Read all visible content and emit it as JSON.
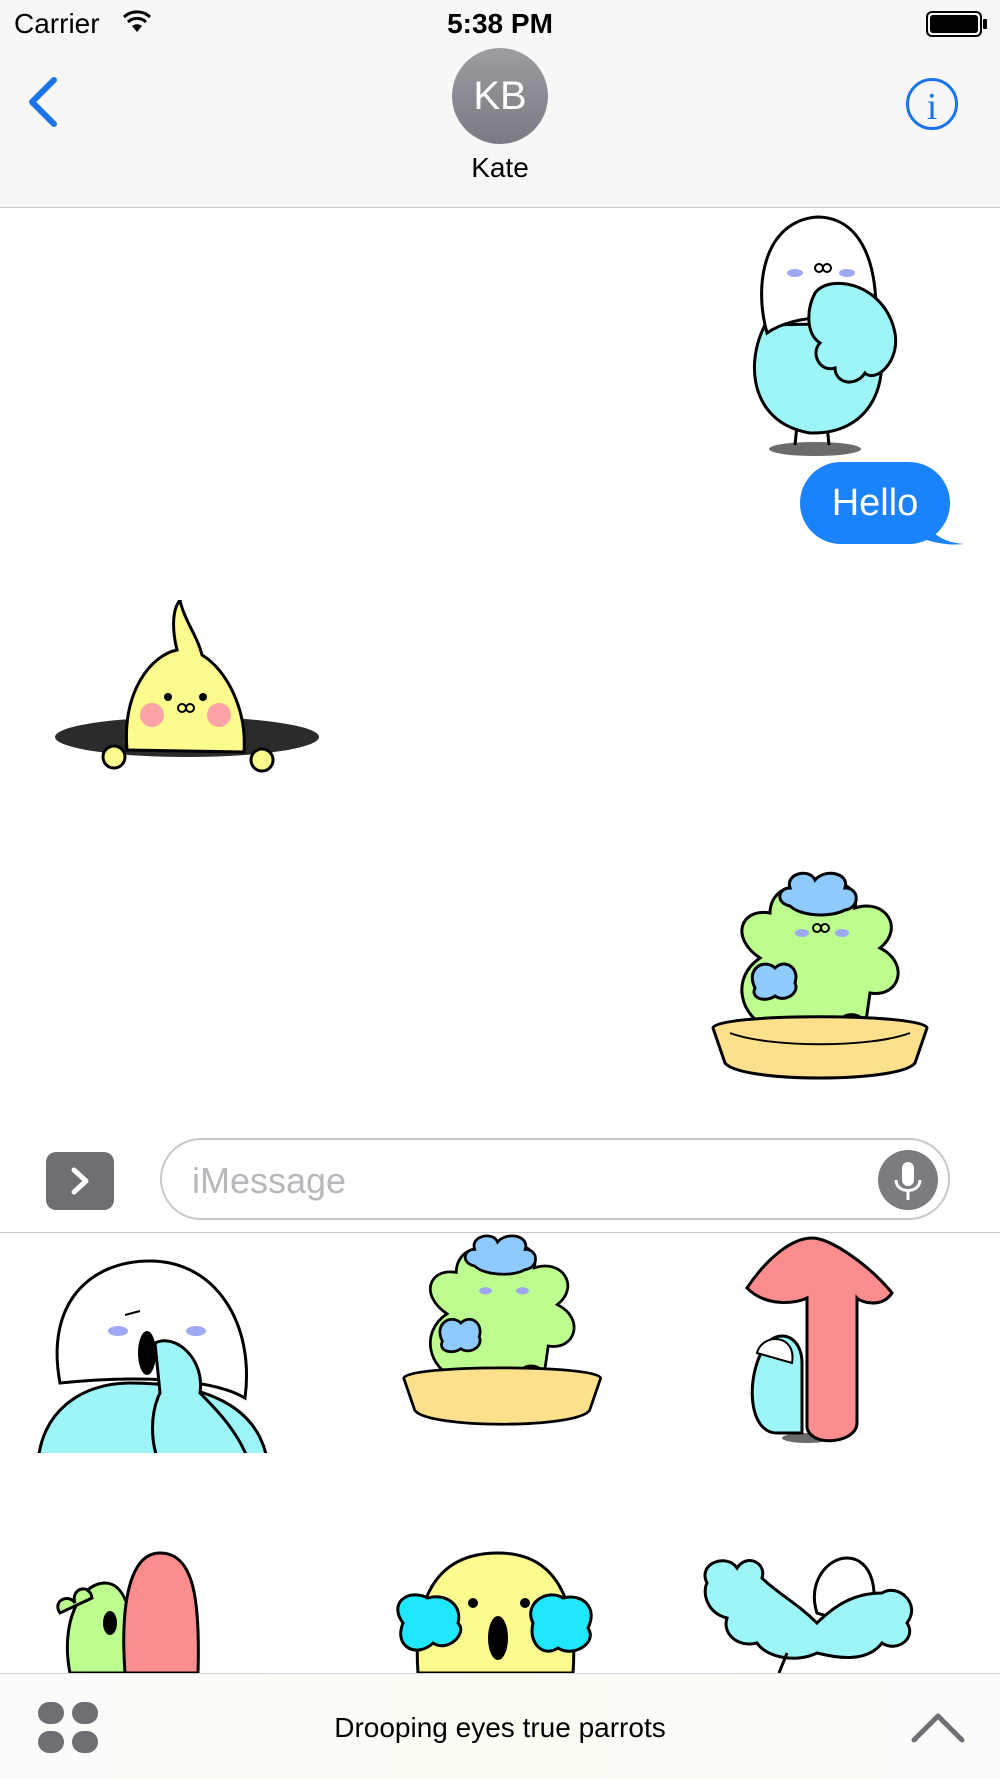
{
  "status_bar": {
    "carrier": "Carrier",
    "time": "5:38 PM"
  },
  "nav": {
    "avatar_initials": "KB",
    "contact_name": "Kate",
    "info_glyph": "i"
  },
  "conversation": {
    "outgoing_message": "Hello"
  },
  "input": {
    "placeholder": "iMessage"
  },
  "drawer": {
    "title": "Drooping eyes true parrots"
  },
  "colors": {
    "accent": "#1a73e8",
    "bubble": "#1a82fb",
    "parakeet_blue": "#9ef5f7",
    "parakeet_green": "#bdfc8e",
    "cockatiel_yellow": "#fdfb8e",
    "mushroom_pink": "#fc8d8f"
  },
  "icons": [
    "wifi-icon",
    "battery-icon",
    "back-chevron-icon",
    "info-icon",
    "apps-toggle-icon",
    "mic-icon",
    "grid-icon",
    "chevron-up-icon"
  ]
}
